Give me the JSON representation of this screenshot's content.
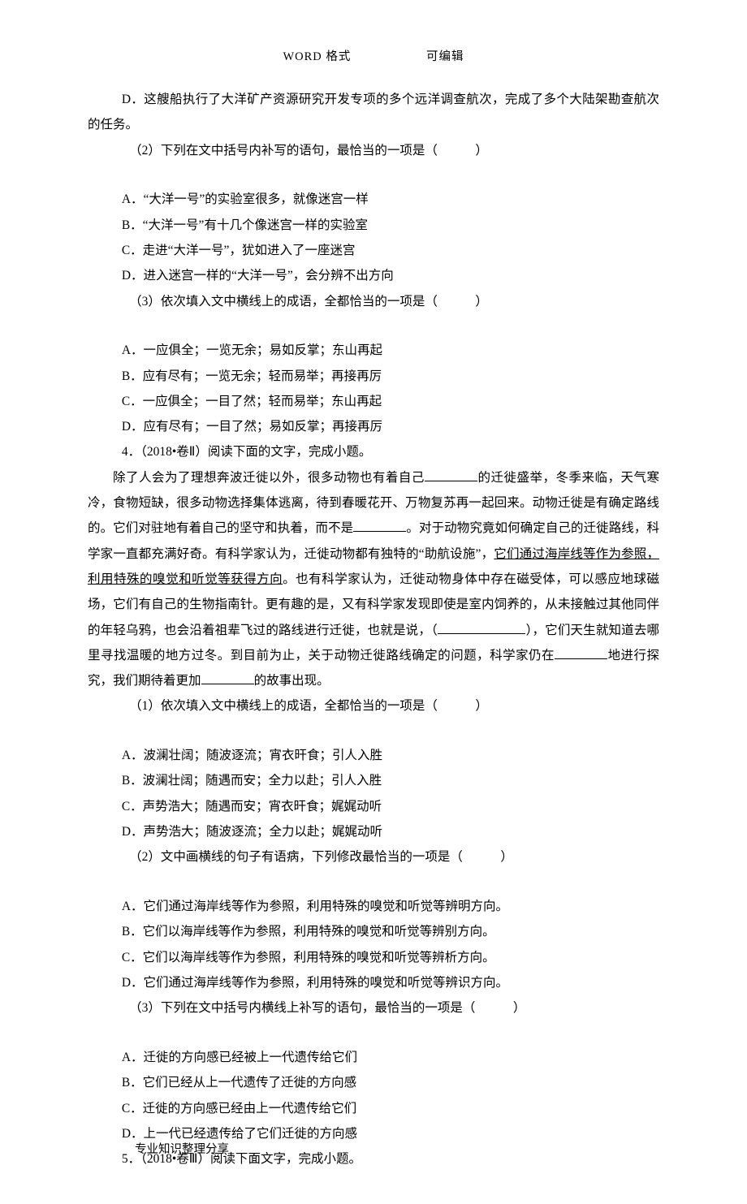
{
  "header": {
    "left": "WORD 格式",
    "right": "可编辑"
  },
  "body": {
    "d_option_before_q2": "D．这艘船执行了大洋矿产资源研究开发专项的多个远洋调查航次，完成了多个大陆架勘查航次的任务。",
    "q2": "（2）下列在文中括号内补写的语句，最恰当的一项是（　　　）",
    "q2_opts": {
      "A": "A．“大洋一号”的实验室很多，就像迷宫一样",
      "B": "B．“大洋一号”有十几个像迷宫一样的实验室",
      "C": "C．走进“大洋一号”，犹如进入了一座迷宫",
      "D": "D．进入迷宫一样的“大洋一号”，会分辨不出方向"
    },
    "q3": "（3）依次填入文中横线上的成语，全都恰当的一项是（　　　）",
    "q3_opts": {
      "A": "A．一应俱全；一览无余；易如反掌；东山再起",
      "B": "B．应有尽有；一览无余；轻而易举；再接再厉",
      "C": "C．一应俱全；一目了然；轻而易举；东山再起",
      "D": "D．应有尽有；一目了然；易如反掌；再接再厉"
    },
    "q4_title": "4．（2018•卷Ⅱ）阅读下面的文字，完成小题。",
    "passage1": {
      "t1": "除了人会为了理想奔波迁徙以外，很多动物也有着自己",
      "t2": "的迁徙盛举，冬季来临，天气寒冷，食物短缺，很多动物选择集体逃离，待到春暖花开、万物复苏再一起回来。动物迁徙是有确定路线的。它们对驻地有着自己的坚守和执着，而不是",
      "t3": "。对于动物究竟如何确定自己的迁徙路线，科学家一直都充满好奇。有科学家认为，迁徙动物都有独特的“助航设施”，",
      "underlined": "它们通过海岸线等作为参照，利用特殊的嗅觉和听觉等获得方向",
      "t4": "。也有科学家认为，迁徙动物身体中存在磁受体，可以感应地球磁场，它们有自己的生物指南针。更有趣的是，又有科学家发现即使是室内饲养的，从未接触过其他同伴的年轻乌鸦，也会沿着祖辈飞过的路线进行迁徙，也就是说，（",
      "t5": "），它们天生就知道去哪里寻找温暖的地方过冬。到目前为止，关于动物迁徙路线确定的问题，科学家仍在",
      "t6": "地进行探究，我们期待着更加",
      "t7": "的故事出现。"
    },
    "q41": "（1）依次填入文中横线上的成语，全都恰当的一项是（　　　）",
    "q41_opts": {
      "A": "A．波澜壮阔；随波逐流；宵衣旰食；引人入胜",
      "B": "B．波澜壮阔；随遇而安；全力以赴；引人入胜",
      "C": "C．声势浩大；随遇而安；宵衣旰食；娓娓动听",
      "D": "D．声势浩大；随波逐流；全力以赴；娓娓动听"
    },
    "q42": "（2）文中画横线的句子有语病，下列修改最恰当的一项是（　　　）",
    "q42_opts": {
      "A": "A．它们通过海岸线等作为参照，利用特殊的嗅觉和听觉等辨明方向。",
      "B": "B．它们以海岸线等作为参照，利用特殊的嗅觉和听觉等辨别方向。",
      "C": "C．它们以海岸线等作为参照，利用特殊的嗅觉和听觉等辨析方向。",
      "D": "D．它们通过海岸线等作为参照，利用特殊的嗅觉和听觉等辨识方向。"
    },
    "q43": "（3）下列在文中括号内横线上补写的语句，最恰当的一项是（　　　）",
    "q43_opts": {
      "A": "A．迁徙的方向感已经被上一代遗传给它们",
      "B": "B．它们已经从上一代遗传了迁徙的方向感",
      "C": "C．迁徙的方向感已经由上一代遗传给它们",
      "D": "D．上一代已经遗传给了它们迁徙的方向感"
    },
    "q5_title": "5．（2018•卷Ⅲ）阅读下面文字，完成小题。"
  },
  "footer": "专业知识整理分享"
}
